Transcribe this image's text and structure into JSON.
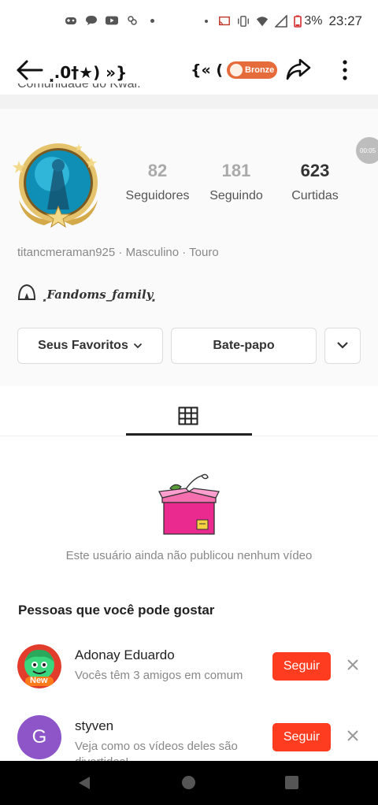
{
  "status_bar": {
    "battery": "3%",
    "time": "23:27"
  },
  "header": {
    "profile_name": "⸼.0†★) »}",
    "deco": "{« (",
    "badge_label": "Bronze"
  },
  "bio_cut": "Comunidade do Kwai.",
  "profile": {
    "stats": [
      {
        "value": "82",
        "label": "Seguidores"
      },
      {
        "value": "181",
        "label": "Seguindo"
      },
      {
        "value": "623",
        "label": "Curtidas"
      }
    ],
    "record_bubble": "00:05",
    "info": "titancmeraman925 · Masculino · Touro",
    "family": "⸼Fandoms_family⸼",
    "buttons": {
      "favorites": "Seus Favoritos",
      "chat": "Bate-papo"
    }
  },
  "empty_state": "Este usuário ainda não publicou nenhum vídeo",
  "suggestions": {
    "title": "Pessoas que você pode gostar",
    "people": [
      {
        "name": "Adonay Eduardo",
        "desc": "Vocês têm 3 amigos em comum",
        "badge": "New",
        "follow": "Seguir"
      },
      {
        "name": "styven",
        "desc": "Veja como os vídeos deles são divertidos!",
        "initial": "G",
        "follow": "Seguir"
      }
    ]
  },
  "colors": {
    "accent": "#fe3d20",
    "badge": "#e56b3a",
    "avatar_g": "#8e55c9"
  }
}
